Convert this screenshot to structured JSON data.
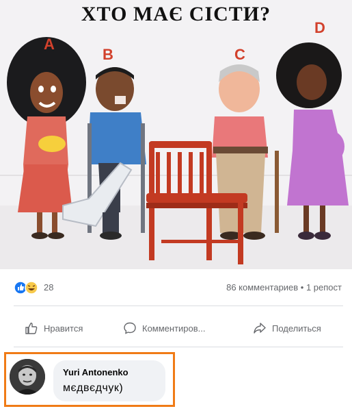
{
  "post": {
    "title": "ХТО МАЄ СІСТИ?",
    "options": [
      "A",
      "B",
      "C",
      "D"
    ]
  },
  "reactions": {
    "count": "28",
    "icons": [
      "like-icon",
      "haha-icon"
    ],
    "stats": "86 комментариев • 1 репост"
  },
  "actions": {
    "like": "Нравится",
    "comment": "Комментиров...",
    "share": "Поделиться"
  },
  "comment": {
    "author": "Yuri Antonenko",
    "text": "мєдвєдчук)"
  },
  "colors": {
    "highlight": "#f07b16",
    "like_blue": "#1877f2",
    "haha_yellow": "#f7c94b",
    "chair_red": "#c33a22",
    "letter_red": "#d2412c"
  }
}
